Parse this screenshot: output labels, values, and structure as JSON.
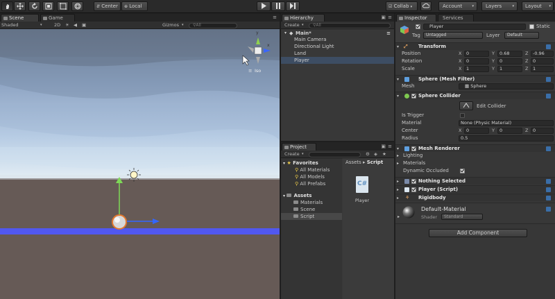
{
  "toolbar": {
    "center_label": "Center",
    "local_label": "Local",
    "collab_label": "Collab",
    "account_label": "Account",
    "layers_label": "Layers",
    "layout_label": "Layout"
  },
  "scene_panel": {
    "tabs": [
      "Scene",
      "Game"
    ],
    "shading_mode": "Shaded",
    "mode_2d": "2D",
    "gizmos_label": "Gizmos",
    "search_placeholder": "All",
    "iso_label": "Iso",
    "gizmo_y": "y",
    "gizmo_x": "x"
  },
  "hierarchy": {
    "tab_label": "Hierarchy",
    "create_label": "Create",
    "search_placeholder": "All",
    "scene_name": "Main*",
    "items": [
      "Main Camera",
      "Directional Light",
      "Land",
      "Player"
    ]
  },
  "project": {
    "tab_label": "Project",
    "create_label": "Create",
    "favorites_label": "Favorites",
    "favorites": [
      "All Materials",
      "All Models",
      "All Prefabs"
    ],
    "assets_label": "Assets",
    "asset_folders": [
      "Materials",
      "Scene",
      "Script"
    ],
    "breadcrumb_root": "Assets",
    "breadcrumb_sep": "▸",
    "breadcrumb_current": "Script",
    "file_name": "Player",
    "file_glyph": "C#"
  },
  "inspector": {
    "tabs": [
      "Inspector",
      "Services"
    ],
    "object_name": "Player",
    "static_label": "Static",
    "tag_label": "Tag",
    "tag_value": "Untagged",
    "layer_label": "Layer",
    "layer_value": "Default",
    "transform": {
      "title": "Transform",
      "rows": [
        {
          "label": "Position",
          "x": "0",
          "y": "0.68",
          "z": "-0.96"
        },
        {
          "label": "Rotation",
          "x": "0",
          "y": "0",
          "z": "0"
        },
        {
          "label": "Scale",
          "x": "1",
          "y": "1",
          "z": "1"
        }
      ],
      "axis_labels": [
        "X",
        "Y",
        "Z"
      ]
    },
    "mesh_filter": {
      "title": "Sphere (Mesh Filter)",
      "mesh_label": "Mesh",
      "mesh_value": "Sphere"
    },
    "sphere_collider": {
      "title": "Sphere Collider",
      "edit_label": "Edit Collider",
      "is_trigger_label": "Is Trigger",
      "material_label": "Material",
      "material_value": "None (Physic Material)",
      "center_label": "Center",
      "center": {
        "x": "0",
        "y": "0",
        "z": "0"
      },
      "radius_label": "Radius",
      "radius_value": "0.5"
    },
    "mesh_renderer": {
      "title": "Mesh Renderer",
      "lighting_label": "Lighting",
      "materials_label": "Materials",
      "dynamic_occluded_label": "Dynamic Occluded"
    },
    "nothing_selected": "Nothing Selected",
    "player_script": "Player (Script)",
    "rigidbody": "Rigidbody",
    "material": {
      "name": "Default-Material",
      "shader_label": "Shader",
      "shader_value": "Standard"
    },
    "add_component_label": "Add Component"
  },
  "colors": {
    "accent_blue": "#3a6ea8",
    "selection": "#3d4d63",
    "ground": "#665a56",
    "player_orange": "#e3782f"
  }
}
